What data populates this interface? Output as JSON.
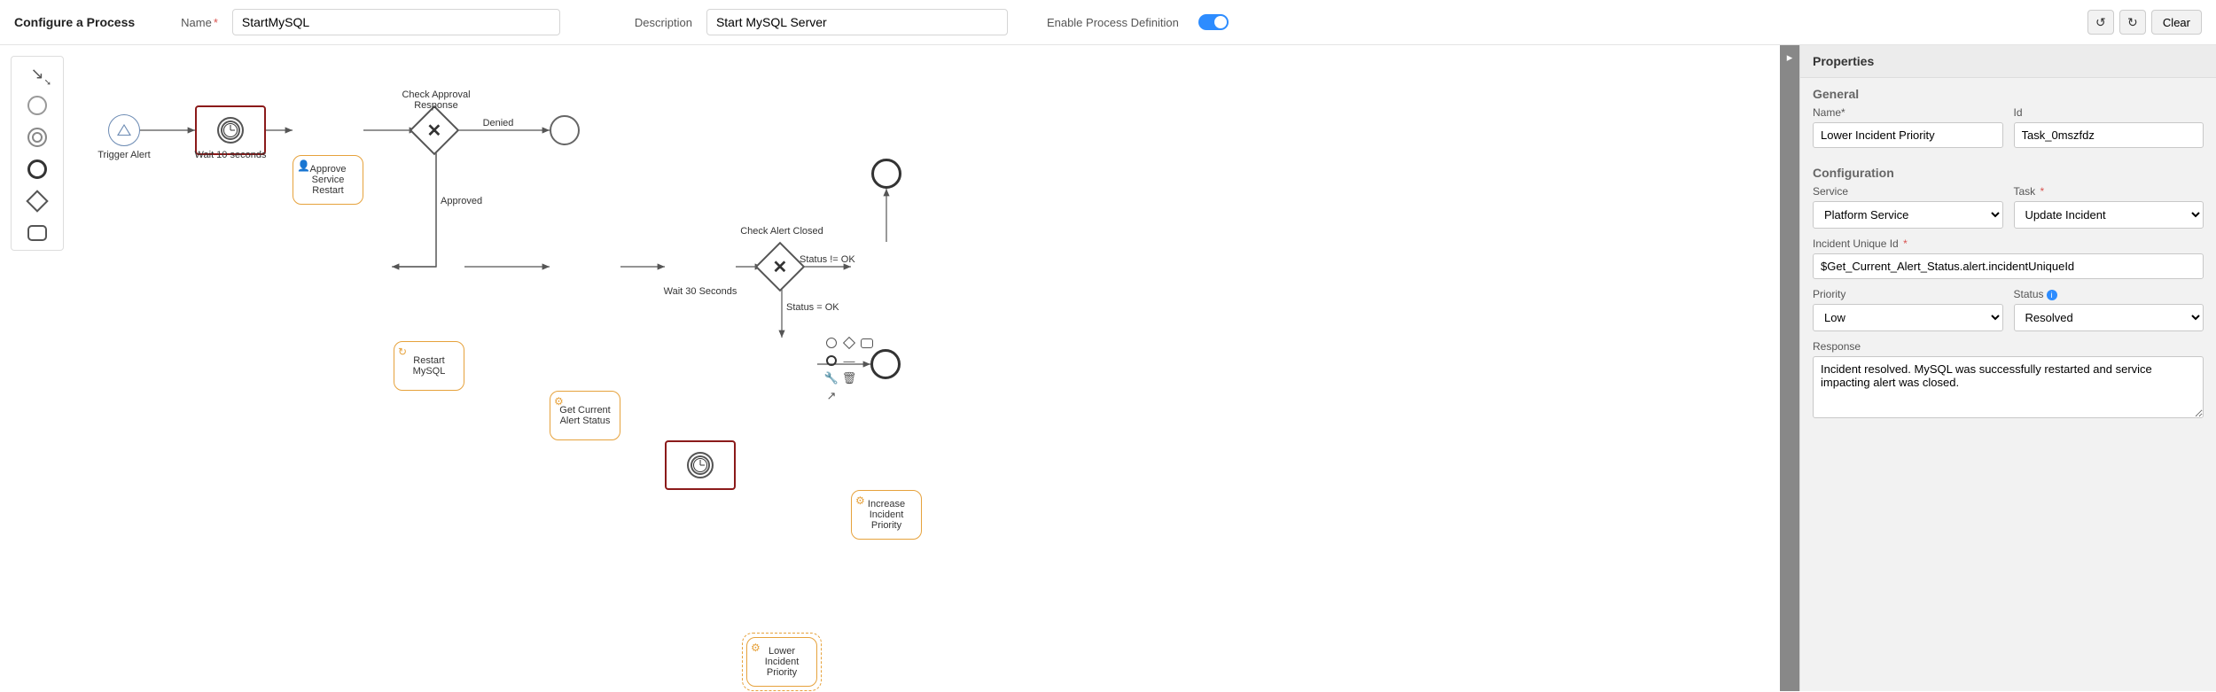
{
  "header": {
    "title": "Configure a Process",
    "name_label": "Name",
    "name_value": "StartMySQL",
    "desc_label": "Description",
    "desc_value": "Start MySQL Server",
    "enable_label": "Enable Process Definition",
    "undo_tooltip": "↺",
    "redo_tooltip": "↻",
    "clear_label": "Clear"
  },
  "canvas": {
    "trigger_alert": "Trigger Alert",
    "wait10": "Wait 10 seconds",
    "approve": "Approve Service Restart",
    "gateway1_label": "Check Approval Response",
    "denied": "Denied",
    "approved": "Approved",
    "restart": "Restart MySQL",
    "get_status": "Get Current Alert Status",
    "wait30": "Wait 30 Seconds",
    "gateway2_label": "Check Alert Closed",
    "status_not_ok": "Status != OK",
    "status_ok": "Status = OK",
    "increase": "Increase Incident Priority",
    "lower": "Lower Incident Priority"
  },
  "props": {
    "panel_title": "Properties",
    "general_title": "General",
    "name_label": "Name*",
    "name_value": "Lower Incident Priority",
    "id_label": "Id",
    "id_value": "Task_0mszfdz",
    "config_title": "Configuration",
    "service_label": "Service",
    "service_value": "Platform Service",
    "task_label": "Task",
    "task_value": "Update Incident",
    "incident_id_label": "Incident Unique Id",
    "incident_id_value": "$Get_Current_Alert_Status.alert.incidentUniqueId",
    "priority_label": "Priority",
    "priority_value": "Low",
    "status_label": "Status",
    "status_value": "Resolved",
    "response_label": "Response",
    "response_value": "Incident resolved. MySQL was successfully restarted and service impacting alert was closed."
  },
  "chart_data": {
    "type": "bpmn_process",
    "nodes": [
      {
        "id": "start",
        "type": "start-event",
        "label": "Trigger Alert"
      },
      {
        "id": "wait10",
        "type": "timer",
        "label": "Wait 10 seconds"
      },
      {
        "id": "approve",
        "type": "user-task",
        "label": "Approve Service Restart"
      },
      {
        "id": "gw1",
        "type": "exclusive-gateway",
        "label": "Check Approval Response"
      },
      {
        "id": "end_denied",
        "type": "end-event",
        "label": ""
      },
      {
        "id": "restart",
        "type": "service-task",
        "label": "Restart MySQL"
      },
      {
        "id": "get_status",
        "type": "service-task",
        "label": "Get Current Alert Status"
      },
      {
        "id": "wait30",
        "type": "timer",
        "label": "Wait 30 Seconds"
      },
      {
        "id": "gw2",
        "type": "exclusive-gateway",
        "label": "Check Alert Closed"
      },
      {
        "id": "increase",
        "type": "service-task",
        "label": "Increase Incident Priority"
      },
      {
        "id": "end_top",
        "type": "end-event",
        "label": ""
      },
      {
        "id": "lower",
        "type": "service-task",
        "label": "Lower Incident Priority",
        "selected": true
      },
      {
        "id": "end_lower",
        "type": "end-event",
        "label": ""
      }
    ],
    "edges": [
      {
        "from": "start",
        "to": "wait10"
      },
      {
        "from": "wait10",
        "to": "approve"
      },
      {
        "from": "approve",
        "to": "gw1"
      },
      {
        "from": "gw1",
        "to": "end_denied",
        "label": "Denied"
      },
      {
        "from": "gw1",
        "to": "restart",
        "label": "Approved"
      },
      {
        "from": "restart",
        "to": "get_status"
      },
      {
        "from": "get_status",
        "to": "wait30"
      },
      {
        "from": "wait30",
        "to": "gw2"
      },
      {
        "from": "gw2",
        "to": "increase",
        "label": "Status != OK"
      },
      {
        "from": "gw2",
        "to": "lower",
        "label": "Status = OK"
      },
      {
        "from": "increase",
        "to": "end_top"
      },
      {
        "from": "lower",
        "to": "end_lower"
      }
    ]
  }
}
